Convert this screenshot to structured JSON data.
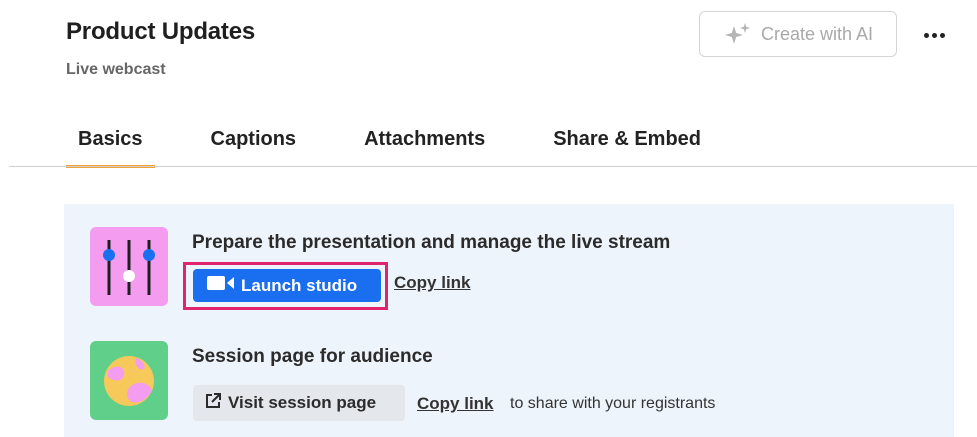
{
  "header": {
    "title": "Product Updates",
    "subtitle": "Live webcast",
    "create_ai_label": "Create with AI",
    "create_ai_icon": "sparkle-icon",
    "more_icon": "more-horizontal-icon"
  },
  "tabs": [
    {
      "label": "Basics",
      "active": true
    },
    {
      "label": "Captions",
      "active": false
    },
    {
      "label": "Attachments",
      "active": false
    },
    {
      "label": "Share & Embed",
      "active": false
    }
  ],
  "studio": {
    "title": "Prepare the presentation and manage the live stream",
    "icon": "sliders-icon",
    "launch_label": "Launch studio",
    "launch_icon": "video-camera-icon",
    "copy_link_label": "Copy link"
  },
  "session": {
    "title": "Session page for audience",
    "icon": "globe-icon",
    "visit_label": "Visit session page",
    "visit_icon": "external-link-icon",
    "copy_link_label": "Copy link",
    "share_note": "to share with your registrants"
  },
  "colors": {
    "accent_tab": "#f0a53a",
    "primary_button": "#1a6ef0",
    "highlight": "#e0246e",
    "panel_bg": "#eef4fb",
    "studio_icon_bg": "#f39cf0",
    "session_icon_bg": "#5fcf8a"
  }
}
